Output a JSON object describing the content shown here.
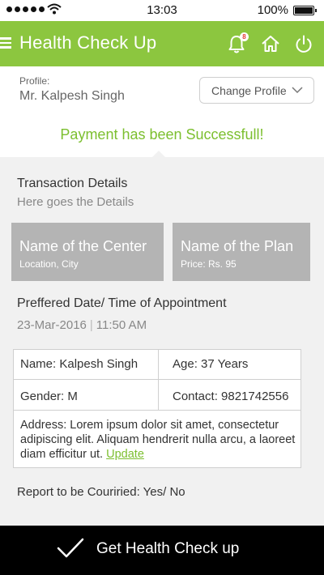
{
  "status_bar": {
    "time": "13:03",
    "battery": "100%"
  },
  "header": {
    "title": "Health Check Up",
    "notification_count": "8"
  },
  "profile": {
    "label": "Profile:",
    "name": "Mr. Kalpesh Singh",
    "change_label": "Change Profile"
  },
  "success_message": "Payment has been Successfull!",
  "transaction": {
    "title": "Transaction Details",
    "subtitle": "Here goes the Details"
  },
  "center": {
    "title": "Name of the Center",
    "subtitle": "Location, City"
  },
  "plan": {
    "title": "Name of the Plan",
    "subtitle": "Price: Rs. 95"
  },
  "appointment": {
    "label": "Preffered Date/ Time of Appointment",
    "date": "23-Mar-2016",
    "separator": "|",
    "time": "11:50 AM"
  },
  "details": {
    "name": "Name: Kalpesh Singh",
    "age": "Age: 37 Years",
    "gender": "Gender: M",
    "contact": "Contact: 9821742556",
    "address": "Address: Lorem ipsum dolor sit amet, consectetur adipiscing elit. Aliquam hendrerit nulla arcu, a laoreet diam efficitur ut.",
    "update_label": "Update"
  },
  "courier": {
    "label": "Report to be Couriried:",
    "value": "Yes/ No"
  },
  "footer": {
    "action_label": "Get Health Check up"
  },
  "colors": {
    "accent": "#8cc63f",
    "success_text": "#7cbf2f",
    "card_bg": "#b4b4b4",
    "footer_bg": "#000000"
  },
  "icons": [
    "menu-icon",
    "bell-icon",
    "home-icon",
    "power-icon",
    "chevron-down-icon",
    "check-icon",
    "wifi-icon",
    "battery-icon"
  ]
}
